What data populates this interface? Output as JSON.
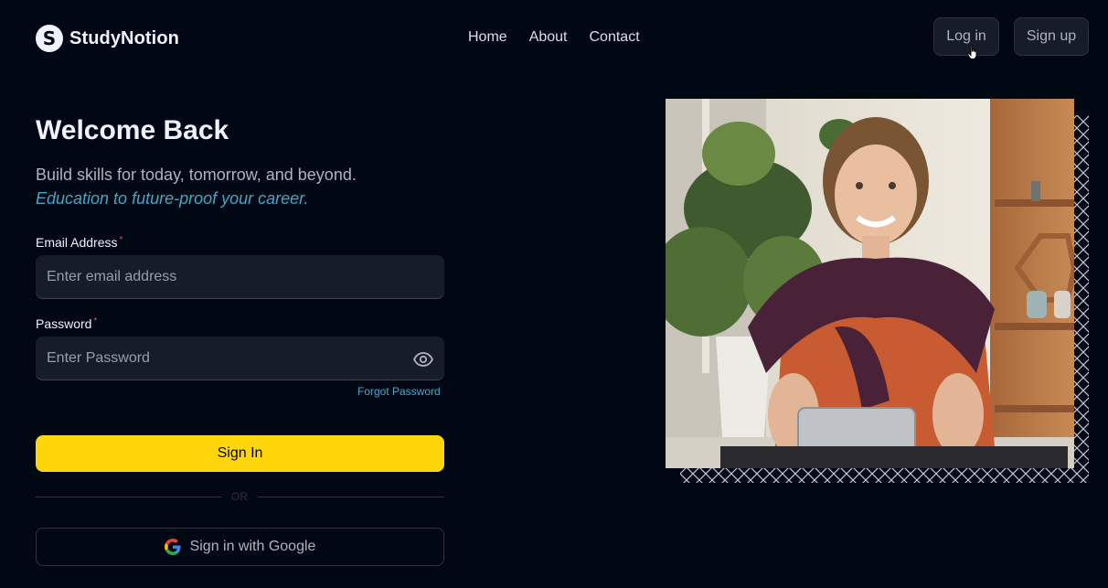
{
  "brand": {
    "name": "StudyNotion",
    "logo_letter": "S"
  },
  "nav": {
    "home": "Home",
    "about": "About",
    "contact": "Contact"
  },
  "auth": {
    "login": "Log in",
    "signup": "Sign up"
  },
  "form": {
    "title": "Welcome Back",
    "subtitle": "Build skills for today, tomorrow, and beyond.",
    "tagline": "Education to future-proof your career.",
    "email_label": "Email Address",
    "email_placeholder": "Enter email address",
    "password_label": "Password",
    "password_placeholder": "Enter Password",
    "required_mark": "*",
    "forgot": "Forgot Password",
    "signin": "Sign In",
    "or": "OR",
    "google": "Sign in with Google"
  },
  "colors": {
    "background": "#000814",
    "accent_yellow": "#FFD60A",
    "accent_blue": "#47A5C5",
    "required_red": "#EF476F"
  },
  "icons": {
    "eye": "eye-icon",
    "google": "google-icon",
    "cursor": "hand-pointer-icon"
  }
}
